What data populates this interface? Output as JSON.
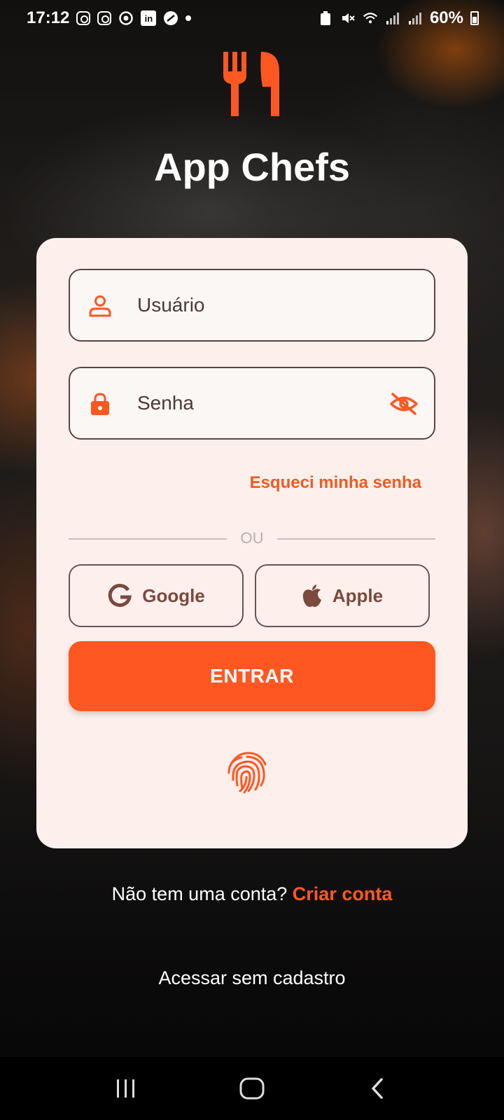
{
  "status_bar": {
    "time": "17:12",
    "battery": "60%",
    "left_icons": [
      "instagram-icon",
      "instagram-icon",
      "chrome-icon",
      "linkedin-icon",
      "app-icon",
      "dot-icon"
    ],
    "right_icons": [
      "recycle-icon",
      "mute-icon",
      "wifi-icon",
      "signal-icon",
      "signal-icon",
      "battery-icon"
    ]
  },
  "brand": {
    "title": "App Chefs",
    "logo_icon": "fork-knife-icon",
    "accent_color": "#ff5722"
  },
  "login_form": {
    "username_placeholder": "Usuário",
    "password_placeholder": "Senha",
    "forgot_password": "Esqueci minha senha",
    "divider_text": "OU",
    "google_label": "Google",
    "apple_label": "Apple",
    "submit_label": "ENTRAR"
  },
  "footer": {
    "no_account_text": "Não tem uma conta?",
    "create_account": "Criar conta",
    "guest_access": "Acessar sem cadastro"
  },
  "nav_bar": {
    "buttons": [
      "recents-icon",
      "home-icon",
      "back-icon"
    ]
  }
}
